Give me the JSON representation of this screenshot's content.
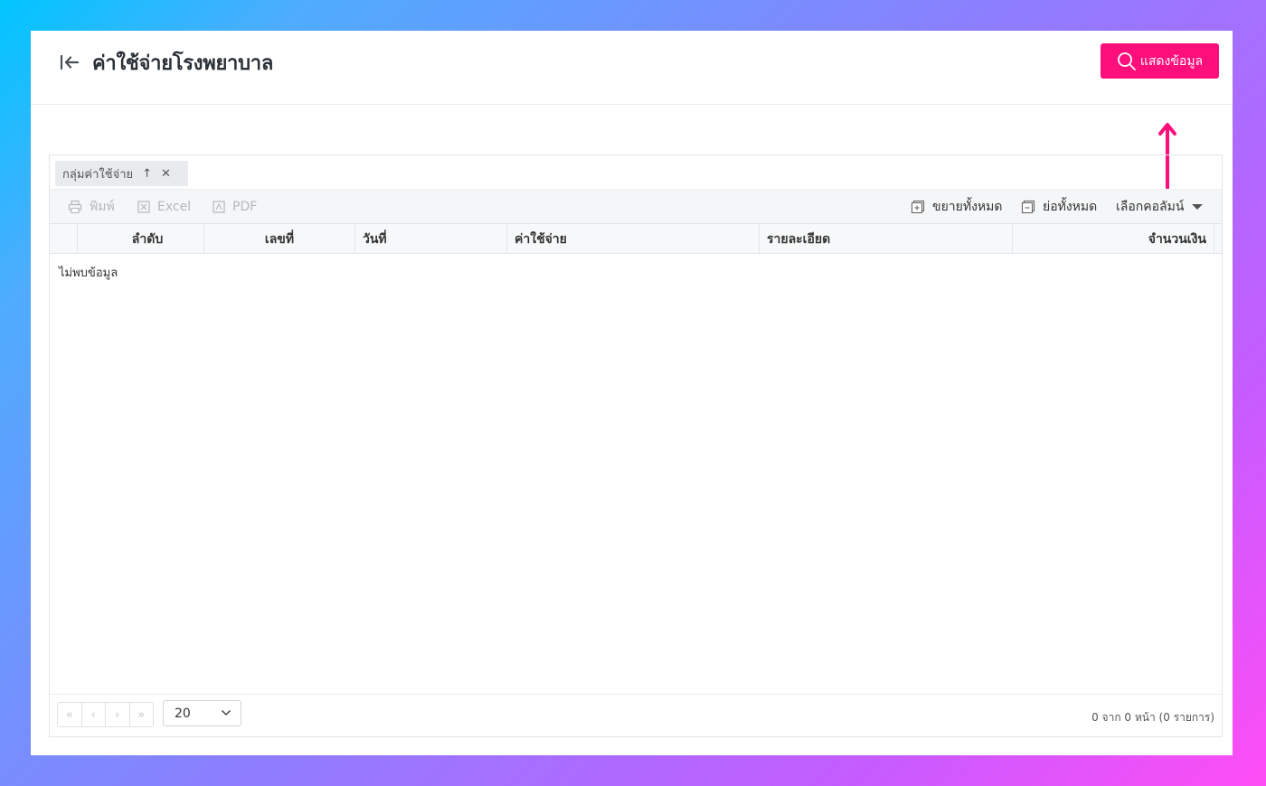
{
  "header": {
    "title": "ค่าใช้จ่ายโรงพยาบาล",
    "show_button_label": "แสดงข้อมูล"
  },
  "group": {
    "chip_label": "กลุ่มค่าใช้จ่าย"
  },
  "toolbar": {
    "print_label": "พิมพ์",
    "excel_label": "Excel",
    "pdf_label": "PDF",
    "expand_all_label": "ขยายทั้งหมด",
    "collapse_all_label": "ย่อทั้งหมด",
    "choose_columns_label": "เลือกคอลัมน์"
  },
  "table": {
    "columns": [
      "ลำดับ",
      "เลขที่",
      "วันที่",
      "ค่าใช้จ่าย",
      "รายละเอียด",
      "จำนวนเงิน"
    ],
    "empty_text": "ไม่พบข้อมูล",
    "rows": []
  },
  "pager": {
    "first_icon": "«",
    "prev_icon": "‹",
    "next_icon": "›",
    "last_icon": "»",
    "page_size": "20",
    "info": "0 จาก 0 หน้า (0 รายการ)"
  },
  "colors": {
    "accent": "#ff0f7b",
    "title": "#2b3138"
  }
}
